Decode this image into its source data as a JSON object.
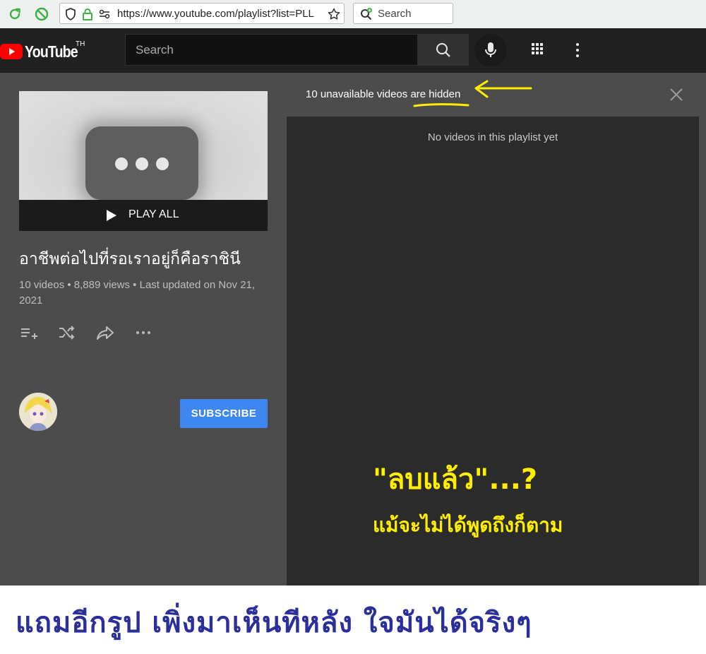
{
  "browser": {
    "url": "https://www.youtube.com/playlist?list=PLL",
    "search_label": "Search"
  },
  "youtube": {
    "logo_text": "YouTube",
    "country_code": "TH",
    "search_placeholder": "Search"
  },
  "playlist": {
    "play_all_label": "PLAY ALL",
    "title": "อาชีพต่อไปที่รอเราอยู่ก็คือราชินี",
    "stats": "10 videos • 8,889 views • Last updated on Nov 21, 2021",
    "subscribe_label": "SUBSCRIBE"
  },
  "videos_panel": {
    "hidden_notice": "10 unavailable videos are hidden",
    "empty_message": "No videos in this playlist yet"
  },
  "annotations": {
    "deleted_question": "\"ลบแล้ว\"...?",
    "even_if_not_said": "แม้จะไม่ได้พูดถึงก็ตาม",
    "bottom_caption": "แถมอีกรูป เพิ่งมาเห็นทีหลัง ใจมันได้จริงๆ",
    "highlight_color": "#ffee00",
    "caption_color": "#2b2f99"
  },
  "colors": {
    "subscribe_blue": "#3f87f0",
    "yt_red": "#ff0000",
    "browser_green": "#3cb043"
  }
}
